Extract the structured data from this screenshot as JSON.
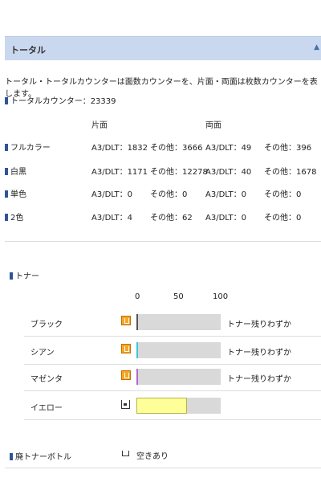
{
  "section": {
    "title": "トータル",
    "collapse_icon": "triangle-up-icon"
  },
  "description": "トータル・トータルカウンターは面数カウンターを、片面・両面は枚数カウンターを表します。",
  "total_counter": "トータルカウンター：23339",
  "table": {
    "col_single": "片面",
    "col_double": "両面",
    "rows": [
      {
        "label": "フルカラー",
        "s_a3": "A3/DLT：1832",
        "s_other": "その他：3666",
        "d_a3": "A3/DLT：49",
        "d_other": "その他：396"
      },
      {
        "label": "白黒",
        "s_a3": "A3/DLT：1171",
        "s_other": "その他：12278",
        "d_a3": "A3/DLT：40",
        "d_other": "その他：1678"
      },
      {
        "label": "単色",
        "s_a3": "A3/DLT：0",
        "s_other": "その他：0",
        "d_a3": "A3/DLT：0",
        "d_other": "その他：0"
      },
      {
        "label": "2色",
        "s_a3": "A3/DLT：4",
        "s_other": "その他：62",
        "d_a3": "A3/DLT：0",
        "d_other": "その他：0"
      }
    ]
  },
  "toner": {
    "title": "トナー",
    "scale": [
      "0",
      "50",
      "100"
    ],
    "items": [
      {
        "name": "ブラック",
        "level": 2,
        "color": "#555555",
        "status": "トナー残りわずか",
        "icon": "toner-low-icon"
      },
      {
        "name": "シアン",
        "level": 2,
        "color": "#3ec6d6",
        "status": "トナー残りわずか",
        "icon": "toner-low-icon"
      },
      {
        "name": "マゼンタ",
        "level": 2,
        "color": "#b06ad0",
        "status": "トナー残りわずか",
        "icon": "toner-low-icon"
      },
      {
        "name": "イエロー",
        "level": 60,
        "color": "#ffff99",
        "status": "",
        "icon": "toner-ok-icon"
      }
    ]
  },
  "waste": {
    "title": "廃トナーボトル",
    "status": "空きあり",
    "icon": "waste-bottle-icon"
  }
}
